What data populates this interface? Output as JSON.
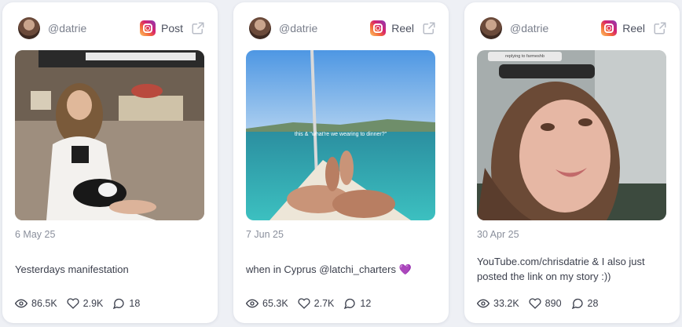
{
  "cards": [
    {
      "handle": "@datrie",
      "type_label": "Post",
      "date": "6 May 25",
      "caption": "Yesterdays manifestation",
      "views": "86.5K",
      "likes": "2.9K",
      "comments": "18"
    },
    {
      "handle": "@datrie",
      "type_label": "Reel",
      "date": "7 Jun 25",
      "caption": "when in Cyprus @latchi_charters 💜",
      "overlay_text": "this & \"what're we wearing to dinner?\"",
      "views": "65.3K",
      "likes": "2.7K",
      "comments": "12"
    },
    {
      "handle": "@datrie",
      "type_label": "Reel",
      "date": "30 Apr 25",
      "caption": "YouTube.com/chrisdatrie & I also just posted the link on my story :))",
      "overlay_text": "replying to farmeshb",
      "views": "33.2K",
      "likes": "890",
      "comments": "28"
    }
  ],
  "colors": {
    "background": "#eef0f5",
    "card": "#ffffff",
    "muted": "#8a8f9c"
  },
  "icons": [
    "instagram-icon",
    "external-link-icon",
    "eye-icon",
    "heart-icon",
    "comment-icon"
  ]
}
